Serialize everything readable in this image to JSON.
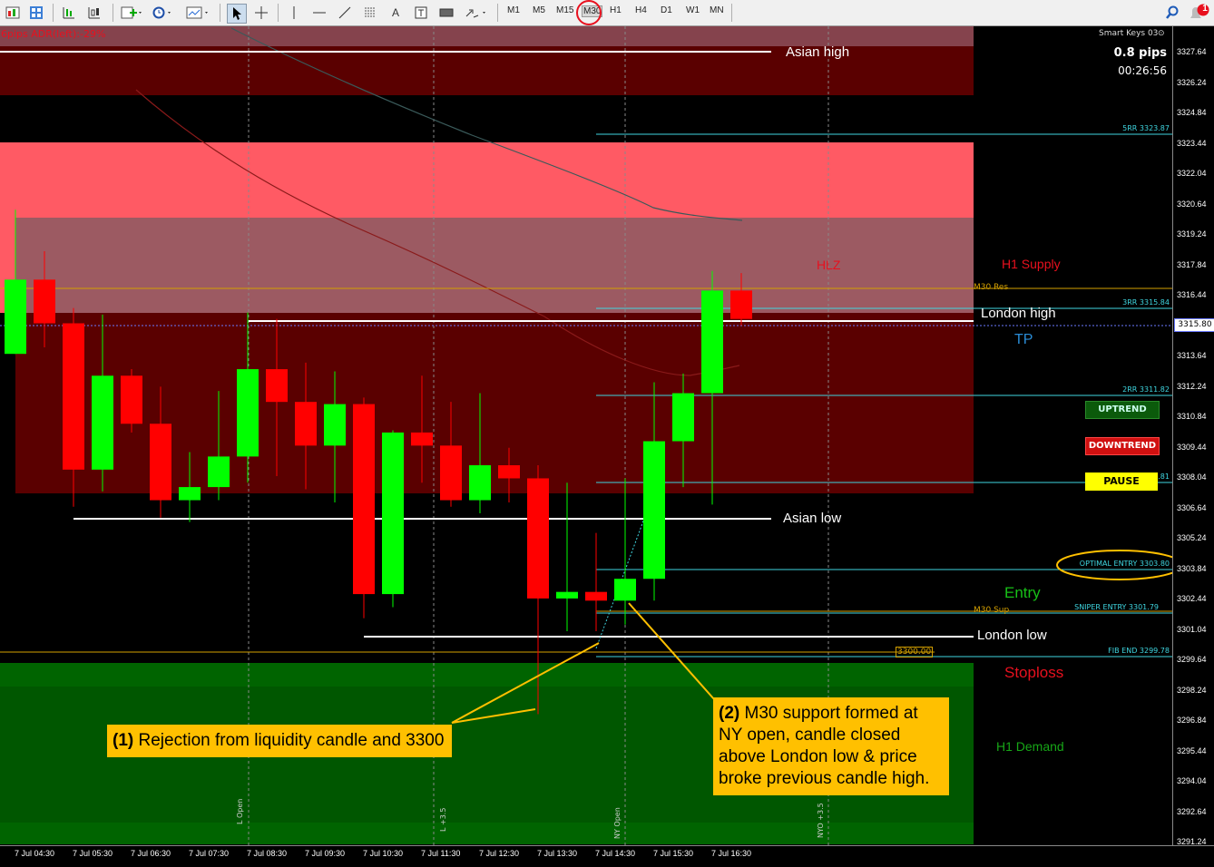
{
  "toolbar": {
    "timeframes": [
      "M1",
      "M5",
      "M15",
      "M30",
      "H1",
      "H4",
      "D1",
      "W1",
      "MN"
    ],
    "selected_timeframe": "M30",
    "notification_count": "1",
    "icons": [
      "new-chart-icon",
      "profiles-icon",
      "chart-bars-icon",
      "chart-candles-icon",
      "add-indicator-icon",
      "history-clock-icon",
      "templates-icon",
      "cursor-icon",
      "crosshair-icon",
      "vertical-line-icon",
      "horizontal-line-icon",
      "trendline-icon",
      "fibo-icon",
      "text-icon",
      "text-label-icon",
      "rectangle-icon",
      "arrows-icon",
      "search-icon",
      "notifications-icon"
    ]
  },
  "indicator_header": "6pips  ADR(left):-29%",
  "info_panel": {
    "name": "Smart Keys 03",
    "spread": "0.8 pips",
    "timer": "00:26:56"
  },
  "zones": {
    "hlz": "HLZ",
    "h1_supply": "H1 Supply",
    "h1_demand": "H1 Demand"
  },
  "levels": {
    "asian_high": "Asian high",
    "asian_low": "Asian low",
    "london_high": "London high",
    "london_low": "London low",
    "tp": "TP",
    "entry": "Entry",
    "stoploss": "Stoploss",
    "m30_res": "M30 Res",
    "m30_sup": "M30 Sup",
    "rr5": "5RR 3323.87",
    "rr3": "3RR 3315.84",
    "rr2": "2RR 3311.82",
    "rr1_partial": ".81",
    "optimal_entry": "OPTIMAL ENTRY 3303.80",
    "sniper_entry": "SNIPER ENTRY 3301.79",
    "fib_end": "FIB END 3299.78",
    "round_level": "3300.00",
    "current_price": "3315.80"
  },
  "buttons": {
    "uptrend": "UPTREND",
    "downtrend": "DOWNTREND",
    "pause": "PAUSE"
  },
  "callouts": {
    "c1_num": "(1)",
    "c1_text": " Rejection from liquidity candle and 3300",
    "c2_num": "(2)",
    "c2_text": " M30 support formed at NY open, candle closed above London low & price broke previous candle high."
  },
  "session_markers": [
    "L Open",
    "L +3.5",
    "NY Open",
    "NYO +3.5"
  ],
  "price_axis": [
    "3327.64",
    "3326.24",
    "3324.84",
    "3323.44",
    "3322.04",
    "3320.64",
    "3319.24",
    "3317.84",
    "3316.44",
    "3315.04",
    "3313.64",
    "3312.24",
    "3310.84",
    "3309.44",
    "3308.04",
    "3306.64",
    "3305.24",
    "3303.84",
    "3302.44",
    "3301.04",
    "3299.64",
    "3298.24",
    "3296.84",
    "3295.44",
    "3294.04",
    "3292.64",
    "3291.24"
  ],
  "time_axis": [
    "7 Jul 04:30",
    "7 Jul 05:30",
    "7 Jul 06:30",
    "7 Jul 07:30",
    "7 Jul 08:30",
    "7 Jul 09:30",
    "7 Jul 10:30",
    "7 Jul 11:30",
    "7 Jul 12:30",
    "7 Jul 13:30",
    "7 Jul 14:30",
    "7 Jul 15:30",
    "7 Jul 16:30"
  ],
  "colors": {
    "bull": "#00ff00",
    "bear": "#ff0000",
    "supply_dark": "#5a0000",
    "supply_light": "#ff5a64",
    "demand": "#006400",
    "accent_red": "#e8101e"
  },
  "chart_data": {
    "type": "candlestick",
    "timeframe": "M30",
    "ylim": [
      3290.7,
      3328.2
    ],
    "candles": [
      {
        "o": 3313.2,
        "h": 3319.8,
        "l": 3313.2,
        "c": 3316.6
      },
      {
        "o": 3316.6,
        "h": 3317.9,
        "l": 3313.5,
        "c": 3314.6
      },
      {
        "o": 3314.6,
        "h": 3315.3,
        "l": 3306.2,
        "c": 3307.9
      },
      {
        "o": 3307.9,
        "h": 3315.0,
        "l": 3306.9,
        "c": 3312.2
      },
      {
        "o": 3312.2,
        "h": 3312.5,
        "l": 3309.6,
        "c": 3310.0
      },
      {
        "o": 3310.0,
        "h": 3311.7,
        "l": 3305.7,
        "c": 3306.5
      },
      {
        "o": 3306.5,
        "h": 3308.7,
        "l": 3305.5,
        "c": 3307.1
      },
      {
        "o": 3307.1,
        "h": 3311.5,
        "l": 3306.5,
        "c": 3308.5
      },
      {
        "o": 3308.5,
        "h": 3315.1,
        "l": 3307.3,
        "c": 3312.5
      },
      {
        "o": 3312.5,
        "h": 3314.8,
        "l": 3307.6,
        "c": 3311.0
      },
      {
        "o": 3311.0,
        "h": 3312.8,
        "l": 3307.0,
        "c": 3309.0
      },
      {
        "o": 3309.0,
        "h": 3312.4,
        "l": 3306.4,
        "c": 3310.9
      },
      {
        "o": 3310.9,
        "h": 3311.2,
        "l": 3301.1,
        "c": 3302.2
      },
      {
        "o": 3302.2,
        "h": 3309.7,
        "l": 3301.6,
        "c": 3309.6
      },
      {
        "o": 3309.6,
        "h": 3312.2,
        "l": 3307.3,
        "c": 3309.0
      },
      {
        "o": 3309.0,
        "h": 3311.0,
        "l": 3306.2,
        "c": 3306.5
      },
      {
        "o": 3306.5,
        "h": 3311.4,
        "l": 3305.9,
        "c": 3308.1
      },
      {
        "o": 3308.1,
        "h": 3308.9,
        "l": 3306.4,
        "c": 3307.5
      },
      {
        "o": 3307.5,
        "h": 3308.1,
        "l": 3296.7,
        "c": 3302.0
      },
      {
        "o": 3302.0,
        "h": 3307.3,
        "l": 3300.5,
        "c": 3302.3
      },
      {
        "o": 3302.3,
        "h": 3305.0,
        "l": 3300.5,
        "c": 3301.9
      },
      {
        "o": 3301.9,
        "h": 3307.5,
        "l": 3300.8,
        "c": 3302.9
      },
      {
        "o": 3302.9,
        "h": 3311.9,
        "l": 3301.9,
        "c": 3309.2
      },
      {
        "o": 3309.2,
        "h": 3312.3,
        "l": 3307.1,
        "c": 3311.4
      },
      {
        "o": 3311.4,
        "h": 3317.0,
        "l": 3306.3,
        "c": 3316.1
      },
      {
        "o": 3316.1,
        "h": 3316.9,
        "l": 3314.5,
        "c": 3314.8
      }
    ]
  }
}
